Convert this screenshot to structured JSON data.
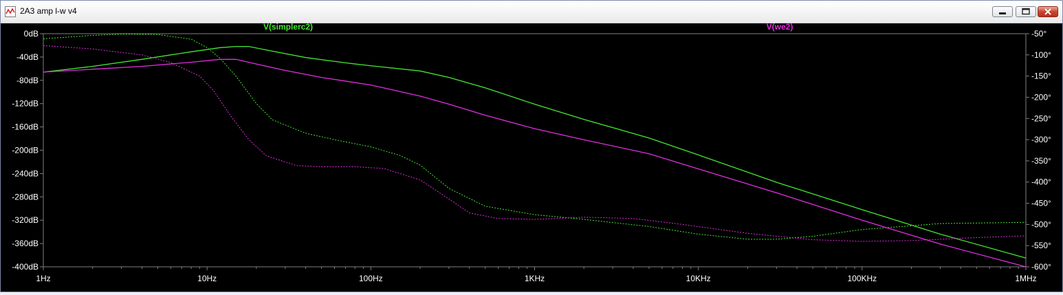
{
  "window": {
    "title": "2A3 amp l-w v4",
    "buttons": {
      "minimize": "minimize",
      "maximize": "maximize",
      "close": "close"
    }
  },
  "icons": {
    "app": "waveform-app-icon",
    "minimize": "minimize-icon",
    "maximize": "maximize-icon",
    "close": "close-icon"
  },
  "colors": {
    "background": "#000000",
    "axis": "#808080",
    "tick_label": "#ffffff",
    "simplerc2": "#44e832",
    "we2": "#e02fe0"
  },
  "chart_data": {
    "type": "line",
    "title": "",
    "xscale": "log",
    "xlim": [
      1,
      1000000
    ],
    "x_ticks": [
      1,
      10,
      100,
      1000,
      10000,
      100000,
      1000000
    ],
    "x_tick_labels": [
      "1Hz",
      "10Hz",
      "100Hz",
      "1KHz",
      "10KHz",
      "100KHz",
      "1MHz"
    ],
    "y_left": {
      "unit": "dB",
      "lim": [
        -400,
        0
      ],
      "ticks": [
        0,
        -40,
        -80,
        -120,
        -160,
        -200,
        -240,
        -280,
        -320,
        -360,
        -400
      ],
      "tick_labels": [
        "0dB",
        "-40dB",
        "-80dB",
        "-120dB",
        "-160dB",
        "-200dB",
        "-240dB",
        "-280dB",
        "-320dB",
        "-360dB",
        "-400dB"
      ]
    },
    "y_right": {
      "unit": "degrees",
      "lim": [
        -600,
        -50
      ],
      "ticks": [
        -50,
        -100,
        -150,
        -200,
        -250,
        -300,
        -350,
        -400,
        -450,
        -500,
        -550,
        -600
      ],
      "tick_labels": [
        "-50°",
        "-100°",
        "-150°",
        "-200°",
        "-250°",
        "-300°",
        "-350°",
        "-400°",
        "-450°",
        "-500°",
        "-550°",
        "-600°"
      ]
    },
    "legend_placement": "top",
    "series": [
      {
        "name": "V(simplerc2)",
        "color": "#44e832",
        "magnitude_db": [
          [
            1,
            -66
          ],
          [
            2,
            -56
          ],
          [
            4,
            -44
          ],
          [
            8,
            -31
          ],
          [
            12,
            -24
          ],
          [
            15,
            -22
          ],
          [
            18,
            -22
          ],
          [
            25,
            -30
          ],
          [
            40,
            -41
          ],
          [
            70,
            -50
          ],
          [
            100,
            -55
          ],
          [
            200,
            -64
          ],
          [
            300,
            -75
          ],
          [
            500,
            -93
          ],
          [
            1000,
            -121
          ],
          [
            2000,
            -147
          ],
          [
            5000,
            -179
          ],
          [
            10000,
            -208
          ],
          [
            30000,
            -255
          ],
          [
            100000,
            -302
          ],
          [
            300000,
            -344
          ],
          [
            1000000,
            -385
          ]
        ],
        "phase_deg": [
          [
            1,
            -62
          ],
          [
            2,
            -54
          ],
          [
            3,
            -51
          ],
          [
            5,
            -52
          ],
          [
            8,
            -63
          ],
          [
            10,
            -83
          ],
          [
            12,
            -108
          ],
          [
            15,
            -150
          ],
          [
            20,
            -215
          ],
          [
            25,
            -253
          ],
          [
            40,
            -285
          ],
          [
            60,
            -300
          ],
          [
            100,
            -317
          ],
          [
            150,
            -337
          ],
          [
            200,
            -360
          ],
          [
            300,
            -415
          ],
          [
            500,
            -457
          ],
          [
            1000,
            -477
          ],
          [
            2000,
            -488
          ],
          [
            5000,
            -505
          ],
          [
            10000,
            -523
          ],
          [
            20000,
            -535
          ],
          [
            30000,
            -535
          ],
          [
            50000,
            -528
          ],
          [
            100000,
            -512
          ],
          [
            300000,
            -498
          ],
          [
            1000000,
            -495
          ]
        ]
      },
      {
        "name": "V(we2)",
        "color": "#e02fe0",
        "magnitude_db": [
          [
            1,
            -66
          ],
          [
            2,
            -61
          ],
          [
            4,
            -56
          ],
          [
            8,
            -49
          ],
          [
            12,
            -44
          ],
          [
            15,
            -44
          ],
          [
            20,
            -52
          ],
          [
            30,
            -63
          ],
          [
            50,
            -75
          ],
          [
            100,
            -88
          ],
          [
            200,
            -107
          ],
          [
            300,
            -121
          ],
          [
            500,
            -140
          ],
          [
            1000,
            -163
          ],
          [
            2000,
            -182
          ],
          [
            5000,
            -206
          ],
          [
            10000,
            -232
          ],
          [
            30000,
            -273
          ],
          [
            100000,
            -320
          ],
          [
            300000,
            -361
          ],
          [
            1000000,
            -400
          ]
        ],
        "phase_deg": [
          [
            1,
            -78
          ],
          [
            2,
            -86
          ],
          [
            4,
            -100
          ],
          [
            6,
            -118
          ],
          [
            9,
            -150
          ],
          [
            11,
            -185
          ],
          [
            14,
            -245
          ],
          [
            18,
            -300
          ],
          [
            23,
            -338
          ],
          [
            35,
            -361
          ],
          [
            50,
            -364
          ],
          [
            80,
            -364
          ],
          [
            120,
            -368
          ],
          [
            200,
            -395
          ],
          [
            300,
            -440
          ],
          [
            400,
            -473
          ],
          [
            600,
            -486
          ],
          [
            1000,
            -488
          ],
          [
            2000,
            -483
          ],
          [
            4000,
            -486
          ],
          [
            8000,
            -500
          ],
          [
            20000,
            -521
          ],
          [
            50000,
            -536
          ],
          [
            100000,
            -540
          ],
          [
            200000,
            -538
          ],
          [
            500000,
            -531
          ],
          [
            1000000,
            -527
          ]
        ]
      }
    ]
  }
}
